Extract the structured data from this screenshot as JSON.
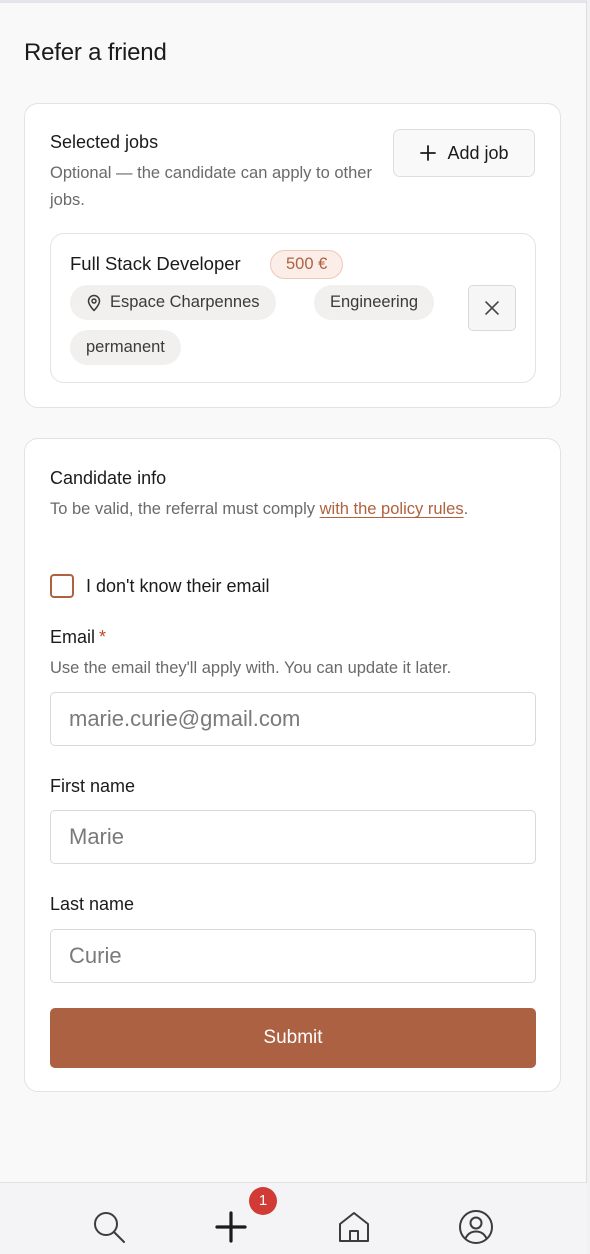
{
  "page": {
    "title": "Refer a friend"
  },
  "jobs": {
    "title": "Selected jobs",
    "description": "Optional — the candidate can apply to other jobs.",
    "add_button_label": "Add job",
    "selected": {
      "title": "Full Stack Developer",
      "bounty": "500 €",
      "location": "Espace Charpennes",
      "department": "Engineering",
      "contract": "permanent"
    }
  },
  "candidate": {
    "title": "Candidate info",
    "description_prefix": "To be valid, the referral must comply ",
    "policy_link": "with the policy rules",
    "description_suffix": ".",
    "no_email_label": "I don't know their email",
    "email_label": "Email",
    "email_required_marker": "*",
    "email_hint": "Use the email they'll apply with. You can update it later.",
    "email_placeholder": "marie.curie@gmail.com",
    "first_name_label": "First name",
    "first_name_placeholder": "Marie",
    "last_name_label": "Last name",
    "last_name_placeholder": "Curie",
    "submit_label": "Submit"
  },
  "nav": {
    "badge_count": "1",
    "items": [
      {
        "icon": "search-icon"
      },
      {
        "icon": "plus-icon"
      },
      {
        "icon": "home-icon"
      },
      {
        "icon": "user-icon"
      }
    ]
  },
  "colors": {
    "accent": "#ac6142",
    "badge": "#d03b35",
    "required": "#c0492e"
  }
}
